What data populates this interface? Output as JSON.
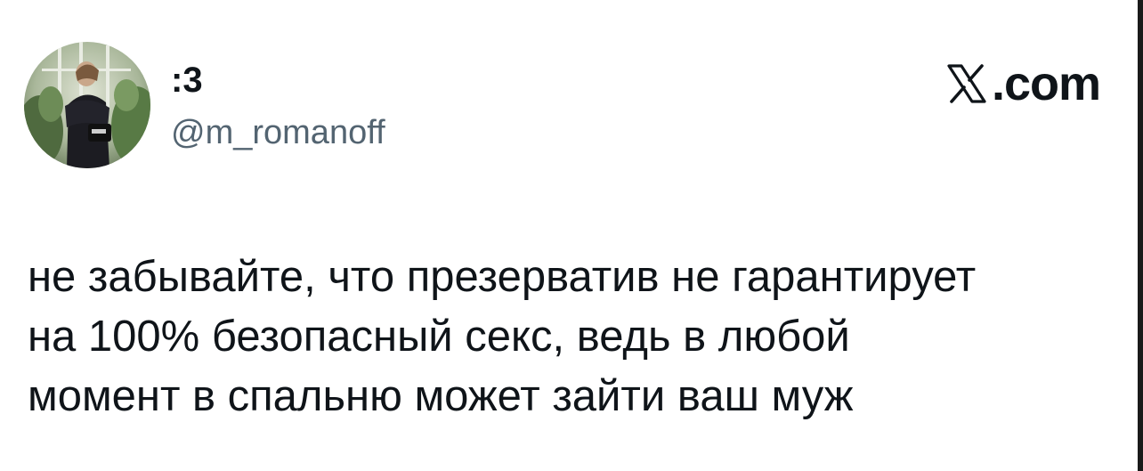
{
  "author": {
    "display_name": ":3",
    "handle": "@m_romanoff",
    "avatar_icon": "user-avatar-photo"
  },
  "brand": {
    "icon": "x-logo-icon",
    "text": ".com"
  },
  "tweet": {
    "lines": [
      "не забывайте, что презерватив не гарантирует",
      "на 100% безопасный секс, ведь в любой",
      "момент в спальню может зайти ваш муж"
    ]
  },
  "colors": {
    "text_primary": "#0f1419",
    "text_secondary": "#536471",
    "background": "#ffffff"
  }
}
